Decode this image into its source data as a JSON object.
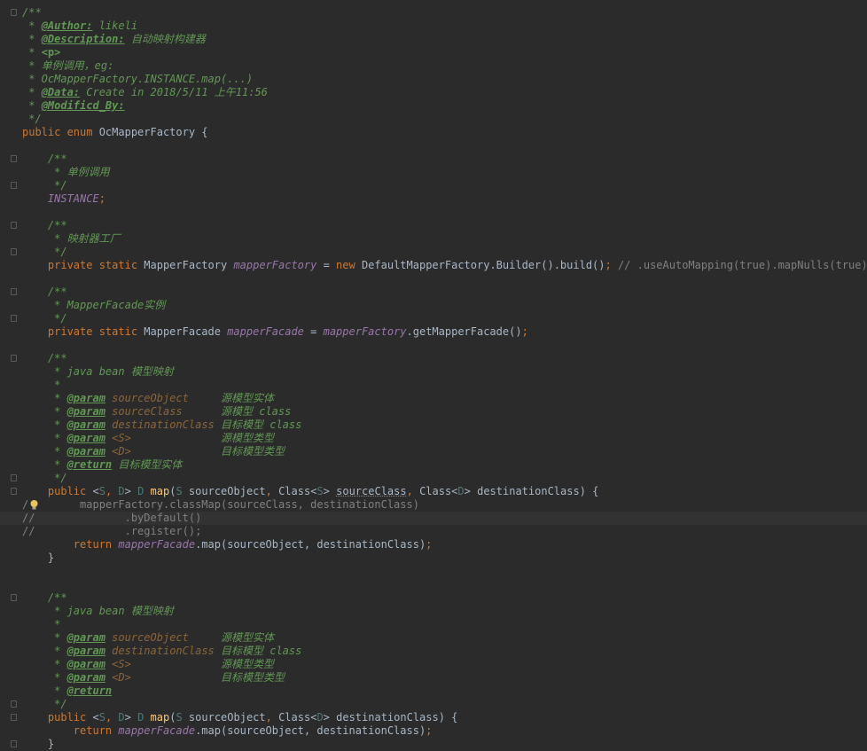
{
  "editor": {
    "language": "java",
    "theme_colors": {
      "background": "#2b2b2b",
      "current_line": "#323232",
      "keyword": "#cc7832",
      "text": "#a9b7c6",
      "doc_comment": "#629755",
      "param_name": "#8a653b",
      "field": "#9876aa",
      "line_comment": "#808080",
      "method_decl": "#ffc66d",
      "type_param": "#507874"
    },
    "lines": [
      [
        [
          "/**",
          "doc"
        ]
      ],
      [
        [
          " * ",
          "doc"
        ],
        [
          "@Author:",
          "dtag"
        ],
        [
          " likeli",
          "doc"
        ]
      ],
      [
        [
          " * ",
          "doc"
        ],
        [
          "@Description:",
          "dtag"
        ],
        [
          " 自动映射构建器",
          "doc"
        ]
      ],
      [
        [
          " * ",
          "doc"
        ],
        [
          "<p>",
          "dtg2"
        ]
      ],
      [
        [
          " * 单例调用，eg:",
          "doc"
        ]
      ],
      [
        [
          " * OcMapperFactory.INSTANCE.map(...)",
          "doc"
        ]
      ],
      [
        [
          " * ",
          "doc"
        ],
        [
          "@Data:",
          "dtag"
        ],
        [
          " Create in 2018/5/11 上午11:56",
          "doc"
        ]
      ],
      [
        [
          " * ",
          "doc"
        ],
        [
          "@Modificd_By:",
          "dtag"
        ]
      ],
      [
        [
          " */",
          "doc"
        ]
      ],
      [
        [
          "public enum ",
          "kw"
        ],
        [
          "OcMapperFactory {",
          "txt"
        ]
      ],
      [],
      [
        [
          "    /**",
          "doc"
        ]
      ],
      [
        [
          "     * 单例调用",
          "doc"
        ]
      ],
      [
        [
          "     */",
          "doc"
        ]
      ],
      [
        [
          "    ",
          "txt"
        ],
        [
          "INSTANCE",
          "field"
        ],
        [
          ";",
          "kw"
        ]
      ],
      [],
      [
        [
          "    /**",
          "doc"
        ]
      ],
      [
        [
          "     * 映射器工厂",
          "doc"
        ]
      ],
      [
        [
          "     */",
          "doc"
        ]
      ],
      [
        [
          "    ",
          "txt"
        ],
        [
          "private static ",
          "kw"
        ],
        [
          "MapperFactory ",
          "txt"
        ],
        [
          "mapperFactory",
          "field"
        ],
        [
          " = ",
          "txt"
        ],
        [
          "new ",
          "kw"
        ],
        [
          "DefaultMapperFactory.Builder().build()",
          "txt"
        ],
        [
          "; ",
          "kw"
        ],
        [
          "// .useAutoMapping(true).mapNulls(true)",
          "lc"
        ]
      ],
      [],
      [
        [
          "    /**",
          "doc"
        ]
      ],
      [
        [
          "     * MapperFacade实例",
          "doc"
        ]
      ],
      [
        [
          "     */",
          "doc"
        ]
      ],
      [
        [
          "    ",
          "txt"
        ],
        [
          "private static ",
          "kw"
        ],
        [
          "MapperFacade ",
          "txt"
        ],
        [
          "mapperFacade",
          "field"
        ],
        [
          " = ",
          "txt"
        ],
        [
          "mapperFactory",
          "field"
        ],
        [
          ".getMapperFacade()",
          "txt"
        ],
        [
          ";",
          "kw"
        ]
      ],
      [],
      [
        [
          "    /**",
          "doc"
        ]
      ],
      [
        [
          "     * java bean 模型映射",
          "doc"
        ]
      ],
      [
        [
          "     *",
          "doc"
        ]
      ],
      [
        [
          "     * ",
          "doc"
        ],
        [
          "@param",
          "dtag"
        ],
        [
          " ",
          "doc"
        ],
        [
          "sourceObject",
          "pn"
        ],
        [
          "     源模型实体",
          "doc"
        ]
      ],
      [
        [
          "     * ",
          "doc"
        ],
        [
          "@param",
          "dtag"
        ],
        [
          " ",
          "doc"
        ],
        [
          "sourceClass",
          "pn"
        ],
        [
          "      源模型 class",
          "doc"
        ]
      ],
      [
        [
          "     * ",
          "doc"
        ],
        [
          "@param",
          "dtag"
        ],
        [
          " ",
          "doc"
        ],
        [
          "destinationClass",
          "pn"
        ],
        [
          " 目标模型 class",
          "doc"
        ]
      ],
      [
        [
          "     * ",
          "doc"
        ],
        [
          "@param",
          "dtag"
        ],
        [
          " ",
          "doc"
        ],
        [
          "<S>",
          "pn"
        ],
        [
          "              源模型类型",
          "doc"
        ]
      ],
      [
        [
          "     * ",
          "doc"
        ],
        [
          "@param",
          "dtag"
        ],
        [
          " ",
          "doc"
        ],
        [
          "<D>",
          "pn"
        ],
        [
          "              目标模型类型",
          "doc"
        ]
      ],
      [
        [
          "     * ",
          "doc"
        ],
        [
          "@return",
          "dtag"
        ],
        [
          " 目标模型实体",
          "doc"
        ]
      ],
      [
        [
          "     */",
          "doc"
        ]
      ],
      [
        [
          "    ",
          "txt"
        ],
        [
          "public ",
          "kw"
        ],
        [
          "<",
          "txt"
        ],
        [
          "S",
          "tp"
        ],
        [
          ", ",
          "kw"
        ],
        [
          "D",
          "tp"
        ],
        [
          "> ",
          "txt"
        ],
        [
          "D ",
          "tp"
        ],
        [
          "map",
          "meth"
        ],
        [
          "(",
          "txt"
        ],
        [
          "S ",
          "tp"
        ],
        [
          "sourceObject",
          "txt"
        ],
        [
          ", ",
          "kw"
        ],
        [
          "Class<",
          "txt"
        ],
        [
          "S",
          "tp"
        ],
        [
          "> ",
          "txt"
        ],
        [
          "sourceClass",
          "un"
        ],
        [
          ", ",
          "kw"
        ],
        [
          "Class<",
          "txt"
        ],
        [
          "D",
          "tp"
        ],
        [
          "> destinationClass) {",
          "txt"
        ]
      ],
      [
        [
          "/",
          "lc"
        ],
        [
          "      ",
          "txt"
        ],
        [
          "  mapperFactory.classMap(sourceClass, destinationClass)",
          "lc"
        ]
      ],
      [
        [
          "//              .byDefault()",
          "lc"
        ]
      ],
      [
        [
          "//              .register();",
          "lc"
        ]
      ],
      [
        [
          "        ",
          "txt"
        ],
        [
          "return ",
          "kw"
        ],
        [
          "mapperFacade",
          "field"
        ],
        [
          ".map(sourceObject, destinationClass)",
          "txt"
        ],
        [
          ";",
          "kw"
        ]
      ],
      [
        [
          "    }",
          "txt"
        ]
      ],
      [],
      [],
      [
        [
          "    /**",
          "doc"
        ]
      ],
      [
        [
          "     * java bean 模型映射",
          "doc"
        ]
      ],
      [
        [
          "     *",
          "doc"
        ]
      ],
      [
        [
          "     * ",
          "doc"
        ],
        [
          "@param",
          "dtag"
        ],
        [
          " ",
          "doc"
        ],
        [
          "sourceObject",
          "pn"
        ],
        [
          "     源模型实体",
          "doc"
        ]
      ],
      [
        [
          "     * ",
          "doc"
        ],
        [
          "@param",
          "dtag"
        ],
        [
          " ",
          "doc"
        ],
        [
          "destinationClass",
          "pn"
        ],
        [
          " 目标模型 class",
          "doc"
        ]
      ],
      [
        [
          "     * ",
          "doc"
        ],
        [
          "@param",
          "dtag"
        ],
        [
          " ",
          "doc"
        ],
        [
          "<S>",
          "pn"
        ],
        [
          "              源模型类型",
          "doc"
        ]
      ],
      [
        [
          "     * ",
          "doc"
        ],
        [
          "@param",
          "dtag"
        ],
        [
          " ",
          "doc"
        ],
        [
          "<D>",
          "pn"
        ],
        [
          "              目标模型类型",
          "doc"
        ]
      ],
      [
        [
          "     * ",
          "doc"
        ],
        [
          "@return",
          "dtag"
        ]
      ],
      [
        [
          "     */",
          "doc"
        ]
      ],
      [
        [
          "    ",
          "txt"
        ],
        [
          "public ",
          "kw"
        ],
        [
          "<",
          "txt"
        ],
        [
          "S",
          "tp"
        ],
        [
          ", ",
          "kw"
        ],
        [
          "D",
          "tp"
        ],
        [
          "> ",
          "txt"
        ],
        [
          "D ",
          "tp"
        ],
        [
          "map",
          "meth"
        ],
        [
          "(",
          "txt"
        ],
        [
          "S ",
          "tp"
        ],
        [
          "sourceObject",
          "txt"
        ],
        [
          ", ",
          "kw"
        ],
        [
          "Class<",
          "txt"
        ],
        [
          "D",
          "tp"
        ],
        [
          "> destinationClass) {",
          "txt"
        ]
      ],
      [
        [
          "        ",
          "txt"
        ],
        [
          "return ",
          "kw"
        ],
        [
          "mapperFacade",
          "field"
        ],
        [
          ".map(sourceObject, destinationClass)",
          "txt"
        ],
        [
          ";",
          "kw"
        ]
      ],
      [
        [
          "    }",
          "txt"
        ]
      ]
    ],
    "current_line": 38,
    "fold_markers": [
      0,
      11,
      13,
      16,
      18,
      21,
      23,
      26,
      35,
      36,
      44,
      52,
      53,
      55
    ],
    "intention_bulb_line": 37
  }
}
